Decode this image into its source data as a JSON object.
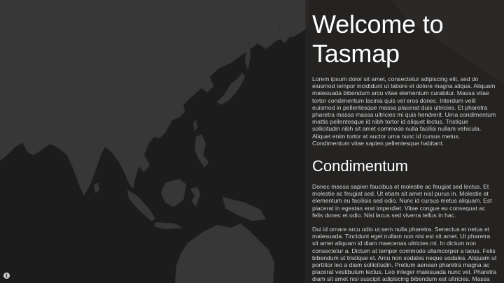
{
  "welcome": {
    "title": "Welcome to Tasmap",
    "intro": "Lorem ipsum dolor sit amet, consectetur adipiscing elit, sed do eiusmod tempor incididunt ut labore et dolore magna aliqua. Aliquam malesuada bibendum arcu vitae elementum curabitur. Massa vitae tortor condimentum lacinia quis vel eros donec. Interdum velit euismod in pellentesque massa placerat duis ultricies. Et pharetra pharetra massa massa ultricies mi quis hendrerit. Urna condimentum mattis pellentesque id nibh tortor id aliquet lectus. Tristique sollicitudin nibh sit amet commodo nulla facilisi nullam vehicula. Aliquet enim tortor at auctor urna nunc id cursus metus. Condimentum vitae sapien pellentesque habitant."
  },
  "section": {
    "heading": "Condimentum",
    "para1": "Donec massa sapien faucibus et molestie ac feugiat sed lectus. Et molestie ac feugiat sed. Ut etiam sit amet nisl purus in. Molestie at elementum eu facilisis sed odio. Nunc id cursus metus aliquam. Est placerat in egestas erat imperdiet. Vitae congue eu consequat ac felis donec et odio. Nisi lacus sed viverra tellus in hac.",
    "para2": "Dui id ornare arcu odio ut sem nulla pharetra. Senectus et netus et malesuada. Tincidunt eget nullam non nisi est sit amet. Ut pharetra sit amet aliquam id diam maecenas ultricies mi. In dictum non consectetur a. Dictum at tempor commodo ullamcorper a lacus. Felis bibendum ut tristique et. Arcu non sodales neque sodales. Aliquam ut porttitor leo a diam sollicitudin. Pretium aenean pharetra magna ac placerat vestibulum lectus. Leo integer malesuada nunc vel. Pharetra diam sit amet nisl suscipit adipiscing bibendum est ultricies. Massa tempor nec"
  },
  "map": {
    "land_color": "#373737",
    "water_color": "#1c1c1c"
  },
  "icons": {
    "info": "info-icon"
  }
}
